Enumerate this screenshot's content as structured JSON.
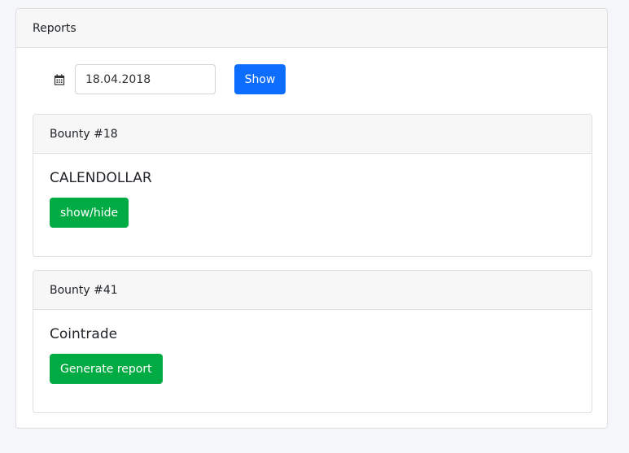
{
  "panel": {
    "title": "Reports"
  },
  "filter": {
    "date_value": "18.04.2018",
    "show_label": "Show"
  },
  "bounties": [
    {
      "header": "Bounty #18",
      "name": "CALENDOLLAR",
      "action_label": "show/hide"
    },
    {
      "header": "Bounty #41",
      "name": "Cointrade",
      "action_label": "Generate report"
    }
  ],
  "colors": {
    "primary": "#0d6efd",
    "success": "#00ab44",
    "header_bg": "#f7f7f7",
    "page_bg": "#f4f6f9"
  },
  "icons": {
    "date": "calendar-icon"
  }
}
